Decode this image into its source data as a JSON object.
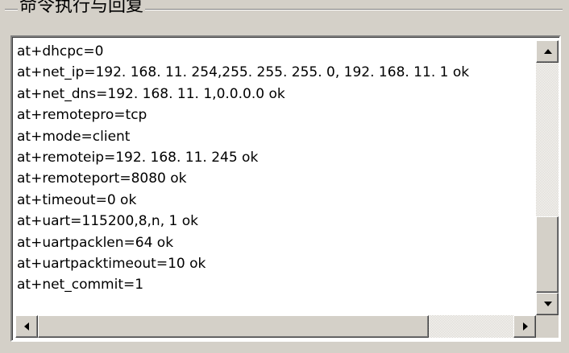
{
  "group": {
    "title": "命令执行与回复"
  },
  "log": {
    "lines": [
      "at+dhcpc=0",
      "at+net_ip=192. 168. 11. 254,255. 255. 255. 0, 192. 168. 11. 1 ok",
      "at+net_dns=192. 168. 11. 1,0.0.0.0 ok",
      "at+remotepro=tcp",
      "at+mode=client",
      "at+remoteip=192. 168. 11. 245 ok",
      "at+remoteport=8080 ok",
      "at+timeout=0 ok",
      "at+uart=115200,8,n, 1 ok",
      "at+uartpacklen=64 ok",
      "at+uartpacktimeout=10 ok",
      "at+net_commit=1"
    ]
  },
  "scrollbars": {
    "vertical": {
      "up_icon": "arrow-up-icon",
      "down_icon": "arrow-down-icon"
    },
    "horizontal": {
      "left_icon": "arrow-left-icon",
      "right_icon": "arrow-right-icon"
    }
  },
  "colors": {
    "window_bg": "#d4d0c8",
    "text_bg": "#ffffff",
    "text": "#000000"
  }
}
